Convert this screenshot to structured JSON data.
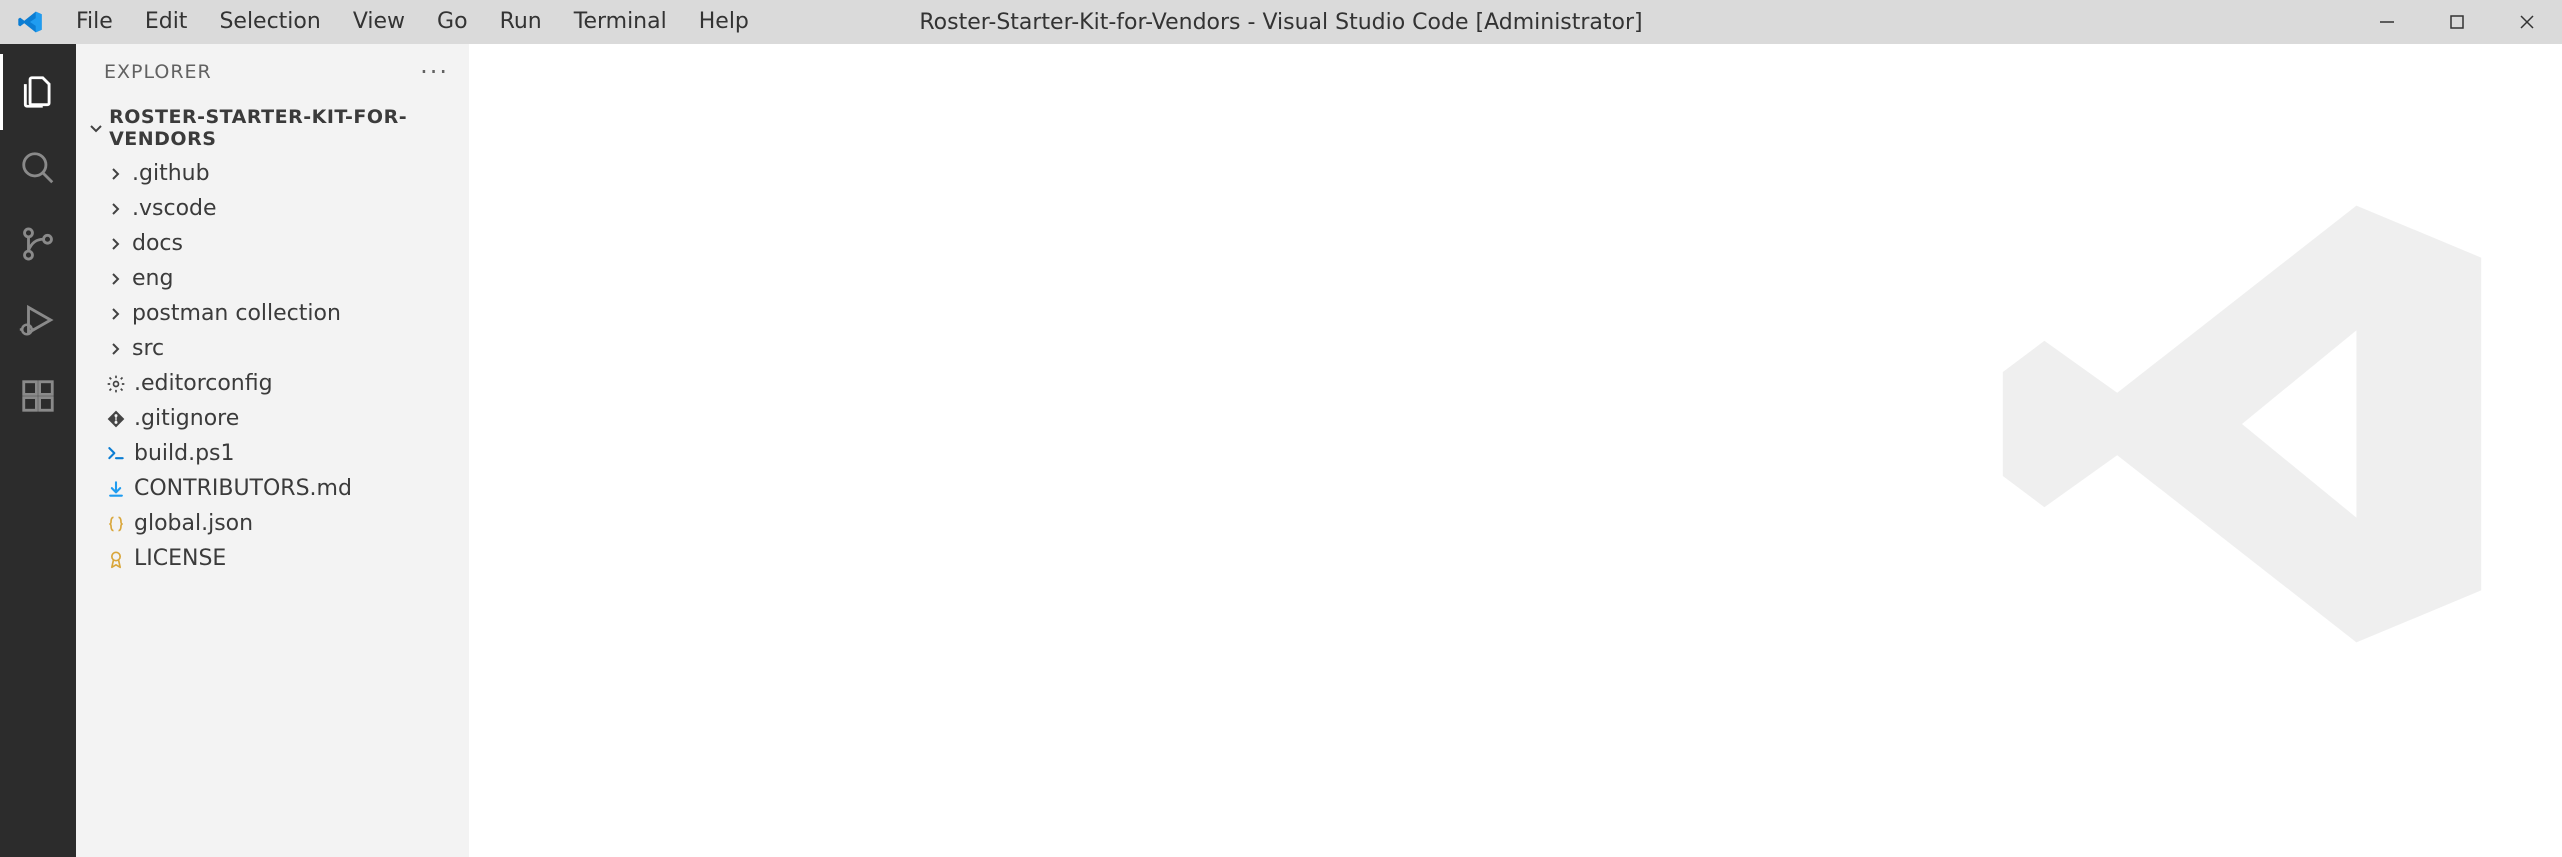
{
  "titlebar": {
    "window_title": "Roster-Starter-Kit-for-Vendors - Visual Studio Code [Administrator]",
    "menu": [
      "File",
      "Edit",
      "Selection",
      "View",
      "Go",
      "Run",
      "Terminal",
      "Help"
    ]
  },
  "activity": {
    "items": [
      {
        "name": "explorer",
        "icon": "files-icon",
        "active": true
      },
      {
        "name": "search",
        "icon": "search-icon",
        "active": false
      },
      {
        "name": "source-control",
        "icon": "git-icon",
        "active": false
      },
      {
        "name": "run-debug",
        "icon": "debug-icon",
        "active": false
      },
      {
        "name": "extensions",
        "icon": "extensions-icon",
        "active": false
      }
    ]
  },
  "sidebar": {
    "title": "EXPLORER",
    "root": "ROSTER-STARTER-KIT-FOR-VENDORS",
    "tree": [
      {
        "type": "folder",
        "name": ".github"
      },
      {
        "type": "folder",
        "name": ".vscode"
      },
      {
        "type": "folder",
        "name": "docs"
      },
      {
        "type": "folder",
        "name": "eng"
      },
      {
        "type": "folder",
        "name": "postman collection"
      },
      {
        "type": "folder",
        "name": "src"
      },
      {
        "type": "file",
        "name": ".editorconfig",
        "icon": "gear"
      },
      {
        "type": "file",
        "name": ".gitignore",
        "icon": "git-file"
      },
      {
        "type": "file",
        "name": "build.ps1",
        "icon": "powershell"
      },
      {
        "type": "file",
        "name": "CONTRIBUTORS.md",
        "icon": "markdown"
      },
      {
        "type": "file",
        "name": "global.json",
        "icon": "json"
      },
      {
        "type": "file",
        "name": "LICENSE",
        "icon": "license"
      }
    ]
  }
}
